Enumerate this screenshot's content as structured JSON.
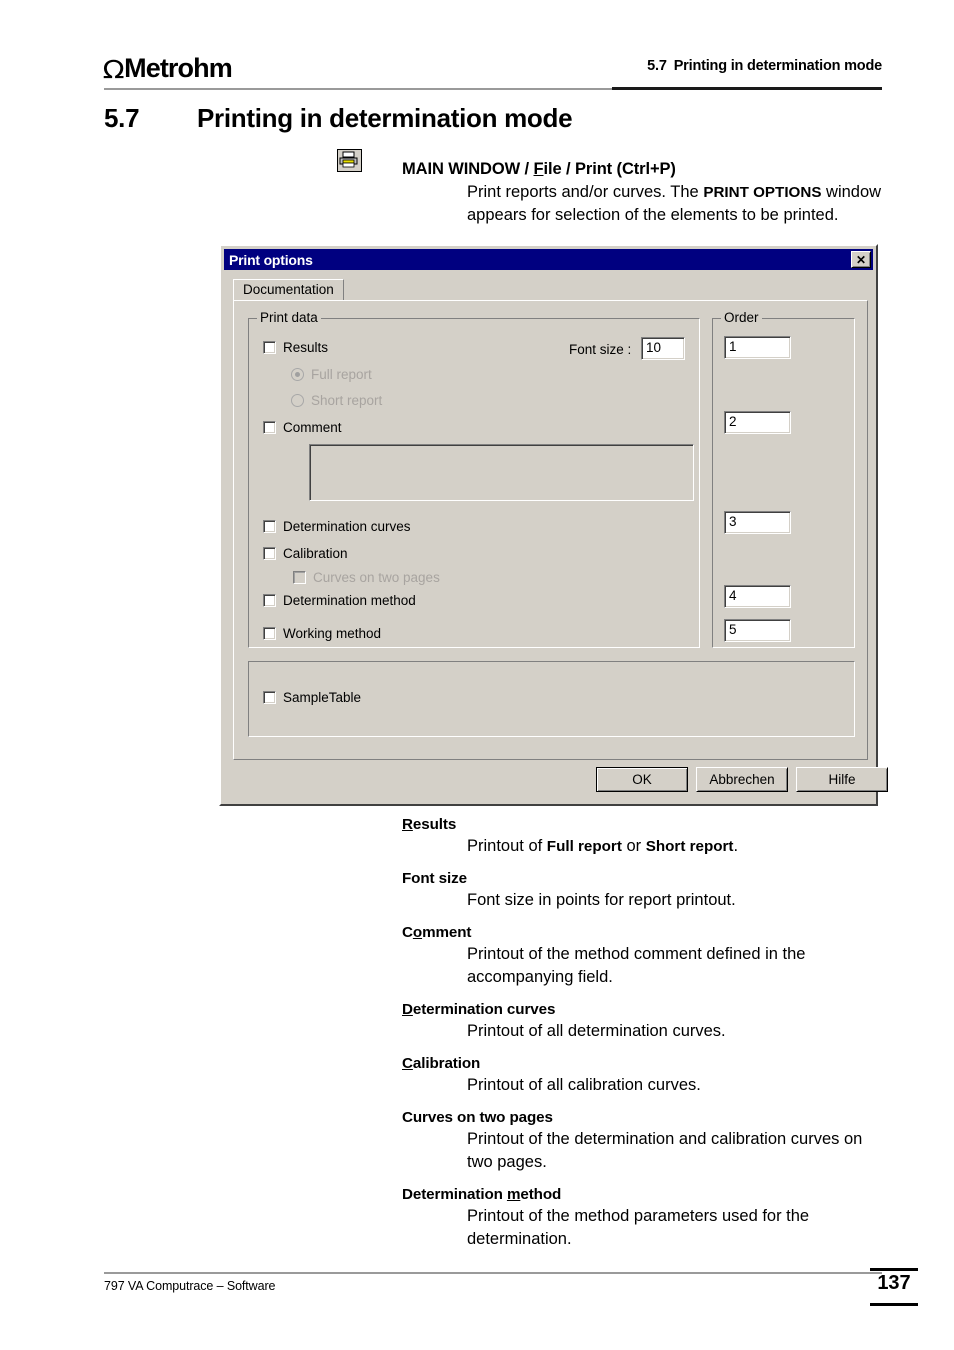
{
  "header": {
    "logo_omega": "Ω",
    "logo_text": "Metrohm",
    "section_number": "5.7",
    "section_title": "Printing in determination mode"
  },
  "section": {
    "number": "5.7",
    "title": "Printing in determination mode"
  },
  "intro": {
    "icon": "printer-icon",
    "lead_prefix": "MAIN WINDOW / ",
    "lead_file": "F",
    "lead_file_rest": "ile / Print  (Ctrl+P)",
    "body_1": "Print reports and/or curves. The ",
    "body_strong": "PRINT OPTIONS",
    "body_2": " window appears for selection of the elements to be printed."
  },
  "dialog": {
    "title": "Print options",
    "close_label": "✕",
    "tab": "Documentation",
    "print_data_group": "Print data",
    "order_group": "Order",
    "font_size_label": "Font size :",
    "font_size_value": "10",
    "comment_value": "",
    "checkboxes": [
      {
        "label": "Results",
        "checked": false,
        "disabled": false
      },
      {
        "label": "Comment",
        "checked": false,
        "disabled": false
      },
      {
        "label": "Determination curves",
        "checked": false,
        "disabled": false
      },
      {
        "label": "Calibration",
        "checked": false,
        "disabled": false
      },
      {
        "label": "Curves on two pages",
        "checked": false,
        "disabled": true
      },
      {
        "label": "Determination method",
        "checked": false,
        "disabled": false
      },
      {
        "label": "Working method",
        "checked": false,
        "disabled": false
      },
      {
        "label": "SampleTable",
        "checked": false,
        "disabled": false
      }
    ],
    "radios": [
      {
        "label": "Full report",
        "checked": true,
        "disabled": true
      },
      {
        "label": "Short report",
        "checked": false,
        "disabled": true
      }
    ],
    "order_values": [
      "1",
      "2",
      "3",
      "4",
      "5"
    ],
    "buttons": {
      "ok": "OK",
      "cancel": "Abbrechen",
      "help": "Hilfe"
    }
  },
  "definitions": [
    {
      "term_u": "R",
      "term_rest": "esults",
      "desc_1": "Printout of ",
      "desc_b1": "Full report",
      "desc_2": " or ",
      "desc_b2": "Short report",
      "desc_3": "."
    },
    {
      "term_u": "",
      "term_rest": "Font size",
      "desc_1": "Font size in points for report printout.",
      "desc_b1": "",
      "desc_2": "",
      "desc_b2": "",
      "desc_3": ""
    },
    {
      "term_pre": "C",
      "term_u": "o",
      "term_rest": "mment",
      "desc_1": "Printout of the method comment defined in the accompanying field.",
      "desc_b1": "",
      "desc_2": "",
      "desc_b2": "",
      "desc_3": ""
    },
    {
      "term_u": "D",
      "term_rest": "etermination curves",
      "desc_1": "Printout of all determination curves.",
      "desc_b1": "",
      "desc_2": "",
      "desc_b2": "",
      "desc_3": ""
    },
    {
      "term_u": "C",
      "term_rest": "alibration",
      "desc_1": "Printout of all calibration curves.",
      "desc_b1": "",
      "desc_2": "",
      "desc_b2": "",
      "desc_3": ""
    },
    {
      "term_u": "",
      "term_rest": "Curves on two pages",
      "desc_1": "Printout of the determination and calibration curves on two pages.",
      "desc_b1": "",
      "desc_2": "",
      "desc_b2": "",
      "desc_3": ""
    },
    {
      "term_pre": "Determination ",
      "term_u": "m",
      "term_rest": "ethod",
      "desc_1": "Printout of the method parameters used for the determination.",
      "desc_b1": "",
      "desc_2": "",
      "desc_b2": "",
      "desc_3": ""
    }
  ],
  "footer": {
    "text": "797 VA Computrace – Software",
    "page": "137"
  }
}
